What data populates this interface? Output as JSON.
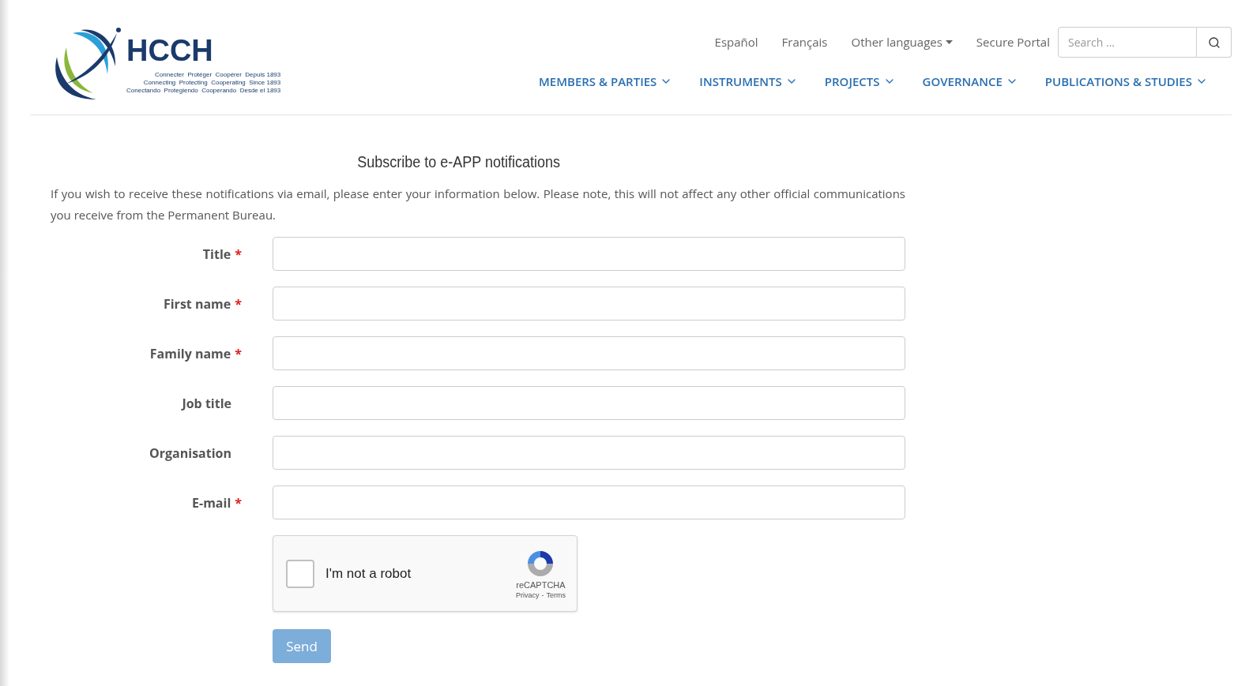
{
  "logo": {
    "name": "HCCH",
    "tagline": [
      "Connecter  Protéger  Coopérer  Depuis 1893",
      "Connecting  Protecting  Cooperating  Since 1893",
      "Conectando  Protegiendo  Cooperando  Desde el 1893"
    ]
  },
  "top_links": [
    {
      "label": "Español",
      "dropdown": false
    },
    {
      "label": "Français",
      "dropdown": false
    },
    {
      "label": "Other languages",
      "dropdown": true
    },
    {
      "label": "Secure Portal",
      "dropdown": false
    }
  ],
  "search": {
    "placeholder": "Search ..."
  },
  "nav": [
    {
      "label": "MEMBERS & PARTIES"
    },
    {
      "label": "INSTRUMENTS"
    },
    {
      "label": "PROJECTS"
    },
    {
      "label": "GOVERNANCE"
    },
    {
      "label": "PUBLICATIONS & STUDIES"
    }
  ],
  "form": {
    "heading": "Subscribe to e-APP notifications",
    "intro": "If you wish to receive these notifications via email, please enter your information below. Please note, this will not affect any other official communications you receive from the Permanent Bureau.",
    "required_mark": "*",
    "fields": [
      {
        "label": "Title",
        "required": true
      },
      {
        "label": "First name",
        "required": true
      },
      {
        "label": "Family name",
        "required": true
      },
      {
        "label": "Job title",
        "required": false
      },
      {
        "label": "Organisation",
        "required": false
      },
      {
        "label": "E-mail",
        "required": true
      }
    ],
    "captcha": {
      "label": "I'm not a robot",
      "checked": false,
      "brand": "reCAPTCHA",
      "privacy": "Privacy",
      "separator": "-",
      "terms": "Terms"
    },
    "submit": {
      "label": "Send",
      "disabled": true
    }
  }
}
